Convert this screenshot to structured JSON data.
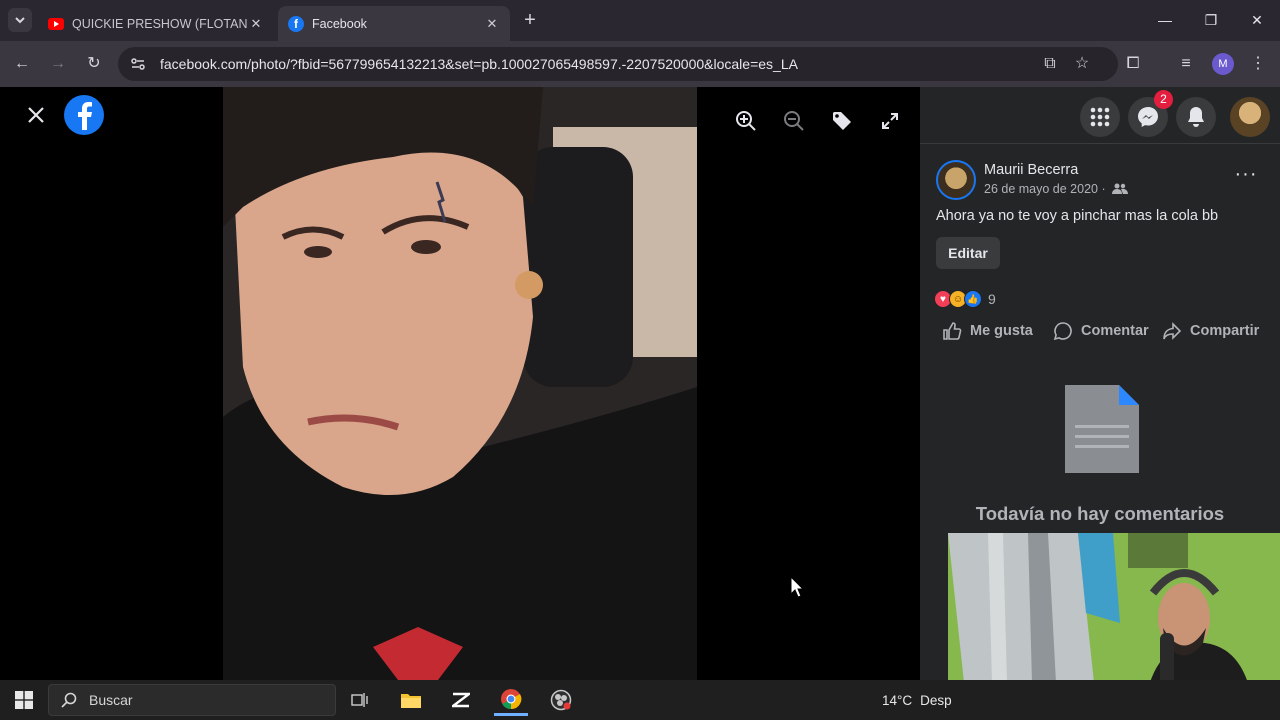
{
  "browser": {
    "tabs": [
      {
        "title": "QUICKIE PRESHOW (FLOTANDO",
        "active": false
      },
      {
        "title": "Facebook",
        "active": true
      }
    ],
    "url": "facebook.com/photo/?fbid=567799654132213&set=pb.100027065498597.-2207520000&locale=es_LA",
    "profile_initial": "M"
  },
  "panel": {
    "messenger_badge": "2",
    "author": "Maurii Becerra",
    "date": "26 de mayo de 2020 ·",
    "caption": "Ahora ya no te voy a pinchar mas la cola bb",
    "edit_label": "Editar",
    "reaction_count": "9",
    "actions": {
      "like": "Me gusta",
      "comment": "Comentar",
      "share": "Compartir"
    },
    "empty_comments": "Todavía no hay comentarios"
  },
  "taskbar": {
    "search_placeholder": "Buscar",
    "temperature": "14°C",
    "weather_text": "Desp"
  },
  "colors": {
    "facebook_blue": "#1877f2",
    "chrome_dark": "#2a2730",
    "panel_bg": "#242526",
    "badge_red": "#e41e3f"
  }
}
